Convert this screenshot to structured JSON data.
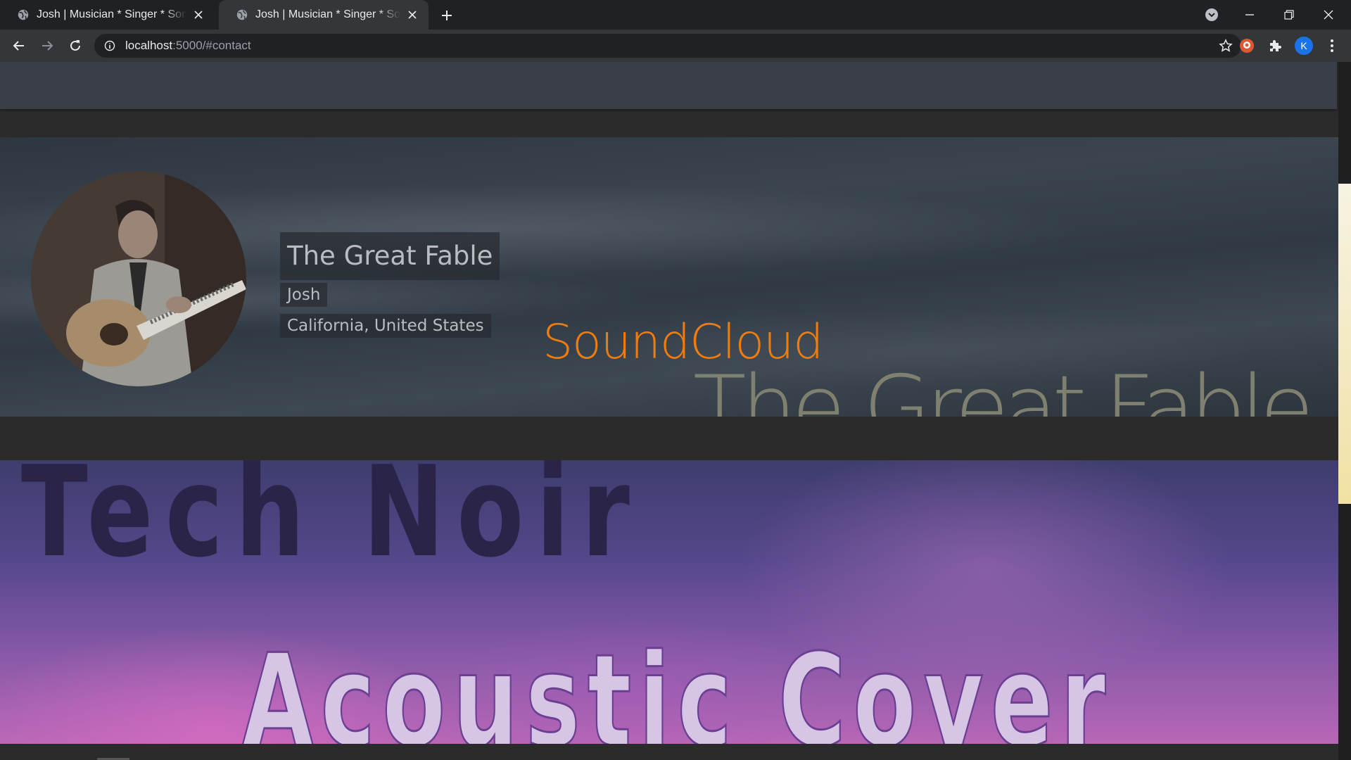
{
  "browser": {
    "tabs": [
      {
        "title": "Josh | Musician * Singer * Songwriter",
        "active": false
      },
      {
        "title": "Josh | Musician * Singer * Songwriter",
        "active": true
      }
    ],
    "url_host": "localhost",
    "url_path": ":5000/#contact",
    "profile_initial": "K"
  },
  "profile": {
    "band_name": "The Great Fable",
    "artist_name": "Josh",
    "location": "California, United States",
    "soundcloud_link": "SoundCloud",
    "banner_logo_text": "The Great Fable"
  },
  "cover_art": {
    "top_text": "Tech Noir",
    "bottom_text": "Acoustic Cover"
  },
  "colors": {
    "soundcloud_orange": "#f07c0e",
    "nav_bar": "#3a3e46",
    "page_bg": "#2b2b2b"
  },
  "icons": [
    "globe-icon",
    "close-icon",
    "plus-icon",
    "chevron-down-icon",
    "minimize-icon",
    "restore-icon",
    "back-arrow-icon",
    "forward-arrow-icon",
    "reload-icon",
    "info-icon",
    "star-icon",
    "extension-icon",
    "puzzle-icon",
    "more-vert-icon"
  ]
}
